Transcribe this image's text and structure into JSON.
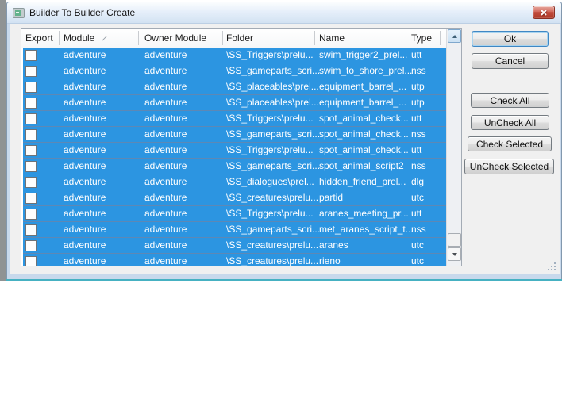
{
  "window": {
    "title": "Builder To Builder Create"
  },
  "list": {
    "columns": {
      "export": "Export",
      "module": "Module",
      "owner_module": "Owner Module",
      "folder": "Folder",
      "name": "Name",
      "type": "Type"
    },
    "sorted_by": "Module",
    "all_rows_selected": true,
    "rows": [
      {
        "export_checked": false,
        "module": "adventure",
        "owner_module": "adventure",
        "folder": "\\SS_Triggers\\prelu...",
        "name": "swim_trigger2_prel...",
        "type": "utt"
      },
      {
        "export_checked": false,
        "module": "adventure",
        "owner_module": "adventure",
        "folder": "\\SS_gameparts_scri...",
        "name": "swim_to_shore_prel...",
        "type": "nss"
      },
      {
        "export_checked": false,
        "module": "adventure",
        "owner_module": "adventure",
        "folder": "\\SS_placeables\\prel...",
        "name": "equipment_barrel_...",
        "type": "utp"
      },
      {
        "export_checked": false,
        "module": "adventure",
        "owner_module": "adventure",
        "folder": "\\SS_placeables\\prel...",
        "name": "equipment_barrel_...",
        "type": "utp"
      },
      {
        "export_checked": false,
        "module": "adventure",
        "owner_module": "adventure",
        "folder": "\\SS_Triggers\\prelu...",
        "name": "spot_animal_check...",
        "type": "utt"
      },
      {
        "export_checked": false,
        "module": "adventure",
        "owner_module": "adventure",
        "folder": "\\SS_gameparts_scri...",
        "name": "spot_animal_check...",
        "type": "nss"
      },
      {
        "export_checked": false,
        "module": "adventure",
        "owner_module": "adventure",
        "folder": "\\SS_Triggers\\prelu...",
        "name": "spot_animal_check...",
        "type": "utt"
      },
      {
        "export_checked": false,
        "module": "adventure",
        "owner_module": "adventure",
        "folder": "\\SS_gameparts_scri...",
        "name": "spot_animal_script2",
        "type": "nss"
      },
      {
        "export_checked": false,
        "module": "adventure",
        "owner_module": "adventure",
        "folder": "\\SS_dialogues\\prel...",
        "name": "hidden_friend_prel...",
        "type": "dlg"
      },
      {
        "export_checked": false,
        "module": "adventure",
        "owner_module": "adventure",
        "folder": "\\SS_creatures\\prelu...",
        "name": "partid",
        "type": "utc"
      },
      {
        "export_checked": false,
        "module": "adventure",
        "owner_module": "adventure",
        "folder": "\\SS_Triggers\\prelu...",
        "name": "aranes_meeting_pr...",
        "type": "utt"
      },
      {
        "export_checked": false,
        "module": "adventure",
        "owner_module": "adventure",
        "folder": "\\SS_gameparts_scri...",
        "name": "met_aranes_script_t...",
        "type": "nss"
      },
      {
        "export_checked": false,
        "module": "adventure",
        "owner_module": "adventure",
        "folder": "\\SS_creatures\\prelu...",
        "name": "aranes",
        "type": "utc"
      },
      {
        "export_checked": false,
        "module": "adventure",
        "owner_module": "adventure",
        "folder": "\\SS_creatures\\prelu...",
        "name": "rieno",
        "type": "utc"
      }
    ]
  },
  "buttons": {
    "ok": "Ok",
    "cancel": "Cancel",
    "check_all": "Check All",
    "uncheck_all": "UnCheck All",
    "check_selected": "Check Selected",
    "uncheck_selected": "UnCheck Selected"
  },
  "colors": {
    "selection_blue": "#2C95E1",
    "row_separator": "#5D88B5",
    "titlebar_gradient_top": "#FBFDFE",
    "titlebar_gradient_bottom": "#D2E2F2",
    "dialog_border_fill": "#C8D9EC",
    "teal_bottom_edge": "#46B1C2",
    "close_button_red": "#C14C3D",
    "client_background": "#F0F0F0"
  }
}
